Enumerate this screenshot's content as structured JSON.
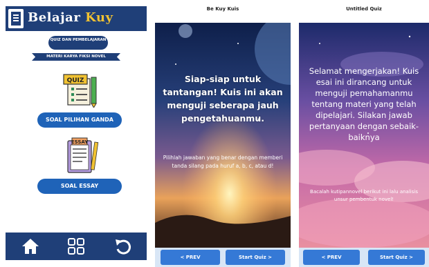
{
  "panel1": {
    "brand_part1": "Belajar",
    "brand_part2": "Kuy",
    "pill_text": "QUIZ DAN PEMBELAJARAN",
    "ribbon_text": "MATERI KARYA FIKSI NOVEL",
    "quiz_icon_label": "QUIZ",
    "essay_icon_label": "ESSAY",
    "button1_label": "SOAL PILIHAN GANDA",
    "button2_label": "SOAL ESSAY",
    "footer_icons": [
      "home-icon",
      "grid-icon",
      "undo-icon"
    ],
    "colors": {
      "navy": "#1f3f78",
      "button_blue": "#1f63b8",
      "yellow": "#f1c232"
    }
  },
  "panel2": {
    "title": "Be Kuy Kuis",
    "heading": "Siap-siap untuk tantangan! Kuis ini akan menguji seberapa jauh pengetahuanmu.",
    "subtext": "Pilihlah jawaban yang benar dengan memberi tanda silang pada  huruf a, b, c, atau d!",
    "prev_label": "< PREV",
    "start_label": "Start Quiz >"
  },
  "panel3": {
    "title": "Untitled Quiz",
    "heading": "Selamat mengerjakan! Kuis esai ini dirancang untuk menguji pemahamanmu tentang materi yang telah dipelajari. Silakan jawab pertanyaan dengan sebaik-baiknya",
    "subtext": "Bacalah kutipannovel berikut ini lalu analisis unsur pembentuk novel!",
    "prev_label": "< PREV",
    "start_label": "Start Quiz >"
  }
}
